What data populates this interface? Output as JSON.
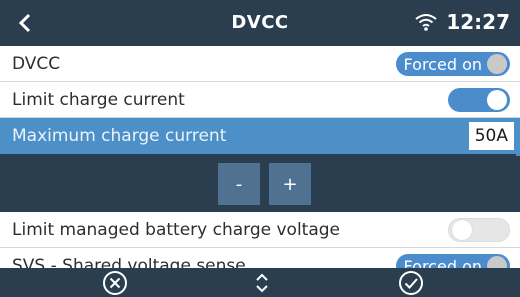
{
  "header": {
    "title": "DVCC",
    "time": "12:27",
    "icons": {
      "back": "back-chevron-icon",
      "wifi": "wifi-icon"
    }
  },
  "rows": [
    {
      "label": "DVCC",
      "control": "pill",
      "value": "Forced on"
    },
    {
      "label": "Limit charge current",
      "control": "toggle",
      "state": "on"
    },
    {
      "label": "Maximum charge current",
      "control": "value",
      "value": "50A",
      "selected": true
    },
    {
      "label": "Limit managed battery charge voltage",
      "control": "toggle",
      "state": "off"
    },
    {
      "label": "SVS - Shared voltage sense",
      "control": "pill",
      "value": "Forced on"
    }
  ],
  "stepper": {
    "minus_label": "-",
    "plus_label": "+"
  },
  "footer": {
    "icons": [
      "cancel-circle-icon",
      "up-down-arrows-icon",
      "confirm-check-circle-icon"
    ]
  },
  "colors": {
    "header_bg": "#2b3e50",
    "accent": "#4a8ccc",
    "selected_row": "#4d90c8",
    "row_bg": "#ffffff",
    "stepper_button": "#4f7192"
  }
}
